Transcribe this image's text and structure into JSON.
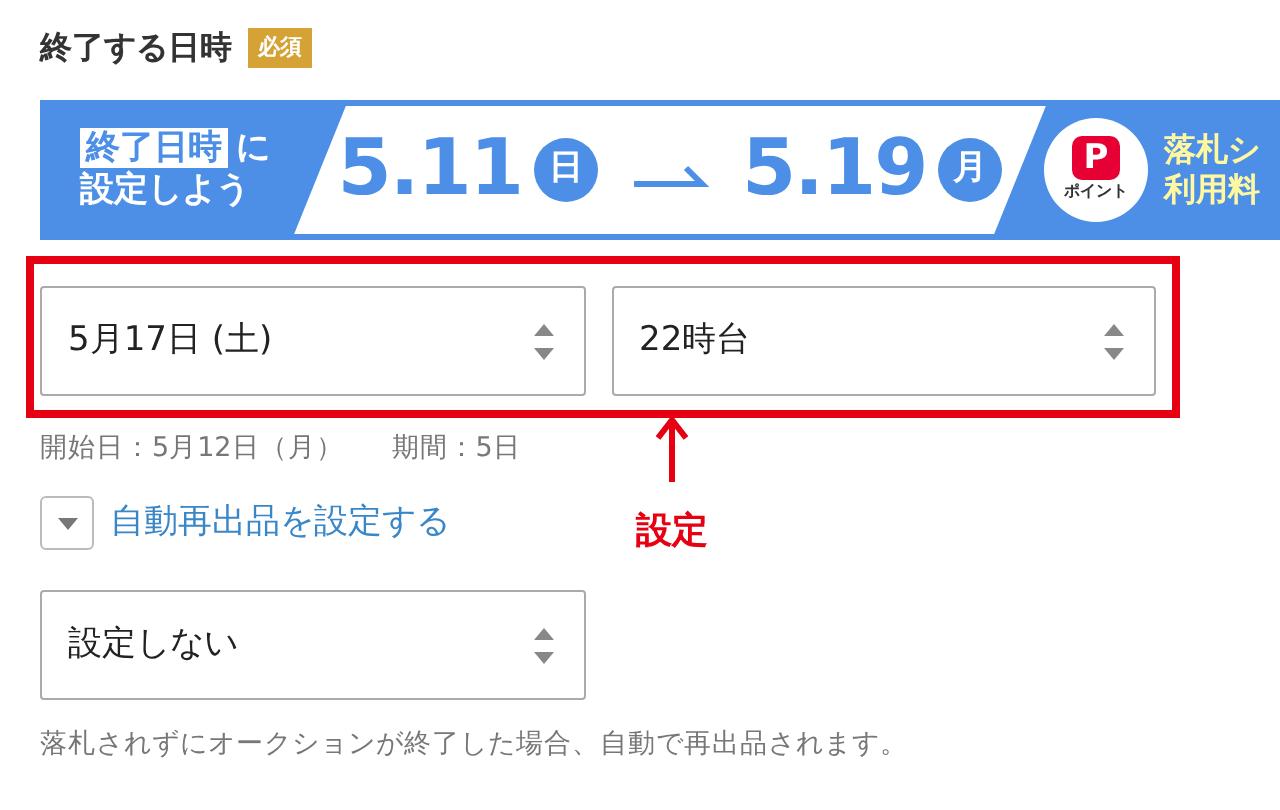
{
  "section": {
    "title": "終了する日時",
    "required_badge": "必須"
  },
  "banner": {
    "highlight": "終了日時",
    "suffix": "に",
    "line2": "設定しよう",
    "start_date": "5.11",
    "start_weekday": "日",
    "end_date": "5.19",
    "end_weekday": "月",
    "logo_letter": "P",
    "logo_caption": "ポイント",
    "side_lines": [
      "落札シ",
      "利用料"
    ]
  },
  "end_date_select": {
    "value": "5月17日 (土)"
  },
  "end_hour_select": {
    "value": "22時台"
  },
  "schedule_note": {
    "start": "開始日：5月12日（月）",
    "period": "期間：5日"
  },
  "annotation": {
    "label": "設定"
  },
  "relist": {
    "toggle_label": "自動再出品を設定する",
    "expanded": false,
    "select_value": "設定しない",
    "note": "落札されずにオークションが終了した場合、自動で再出品されます。"
  }
}
